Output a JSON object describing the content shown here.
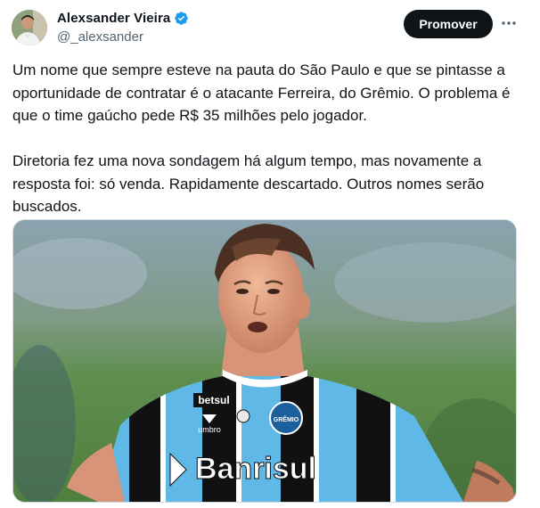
{
  "author": {
    "display_name": "Alexsander Vieira",
    "handle": "@_alexsander",
    "verified": true,
    "verified_color": "#1d9bf0",
    "avatar_icon": "profile-avatar"
  },
  "actions": {
    "promote_label": "Promover",
    "more_icon": "more-horizontal-icon"
  },
  "tweet": {
    "paragraph_1": "Um nome que sempre esteve na pauta do São Paulo e que se pintasse a oportunidade de contratar é o atacante Ferreira, do Grêmio. O problema é que o time gaúcho pede R$ 35 milhões pelo jogador.",
    "paragraph_2": "Diretoria fez uma nova sondagem há algum tempo, mas novamente a resposta foi: só venda. Rapidamente descartado. Outros nomes serão buscados."
  },
  "media": {
    "shirt_sponsor": "Banrisul",
    "chest_sponsor": "betsul",
    "kit_brand": "umbro",
    "club_crest": "GRÊMIO",
    "colors": {
      "sky_blue": "#5fb8e6",
      "black": "#111111",
      "pitch": "#5d8a4e"
    }
  },
  "theme": {
    "text": "#0f1419",
    "secondary": "#536471",
    "button_bg": "#0f1419"
  }
}
